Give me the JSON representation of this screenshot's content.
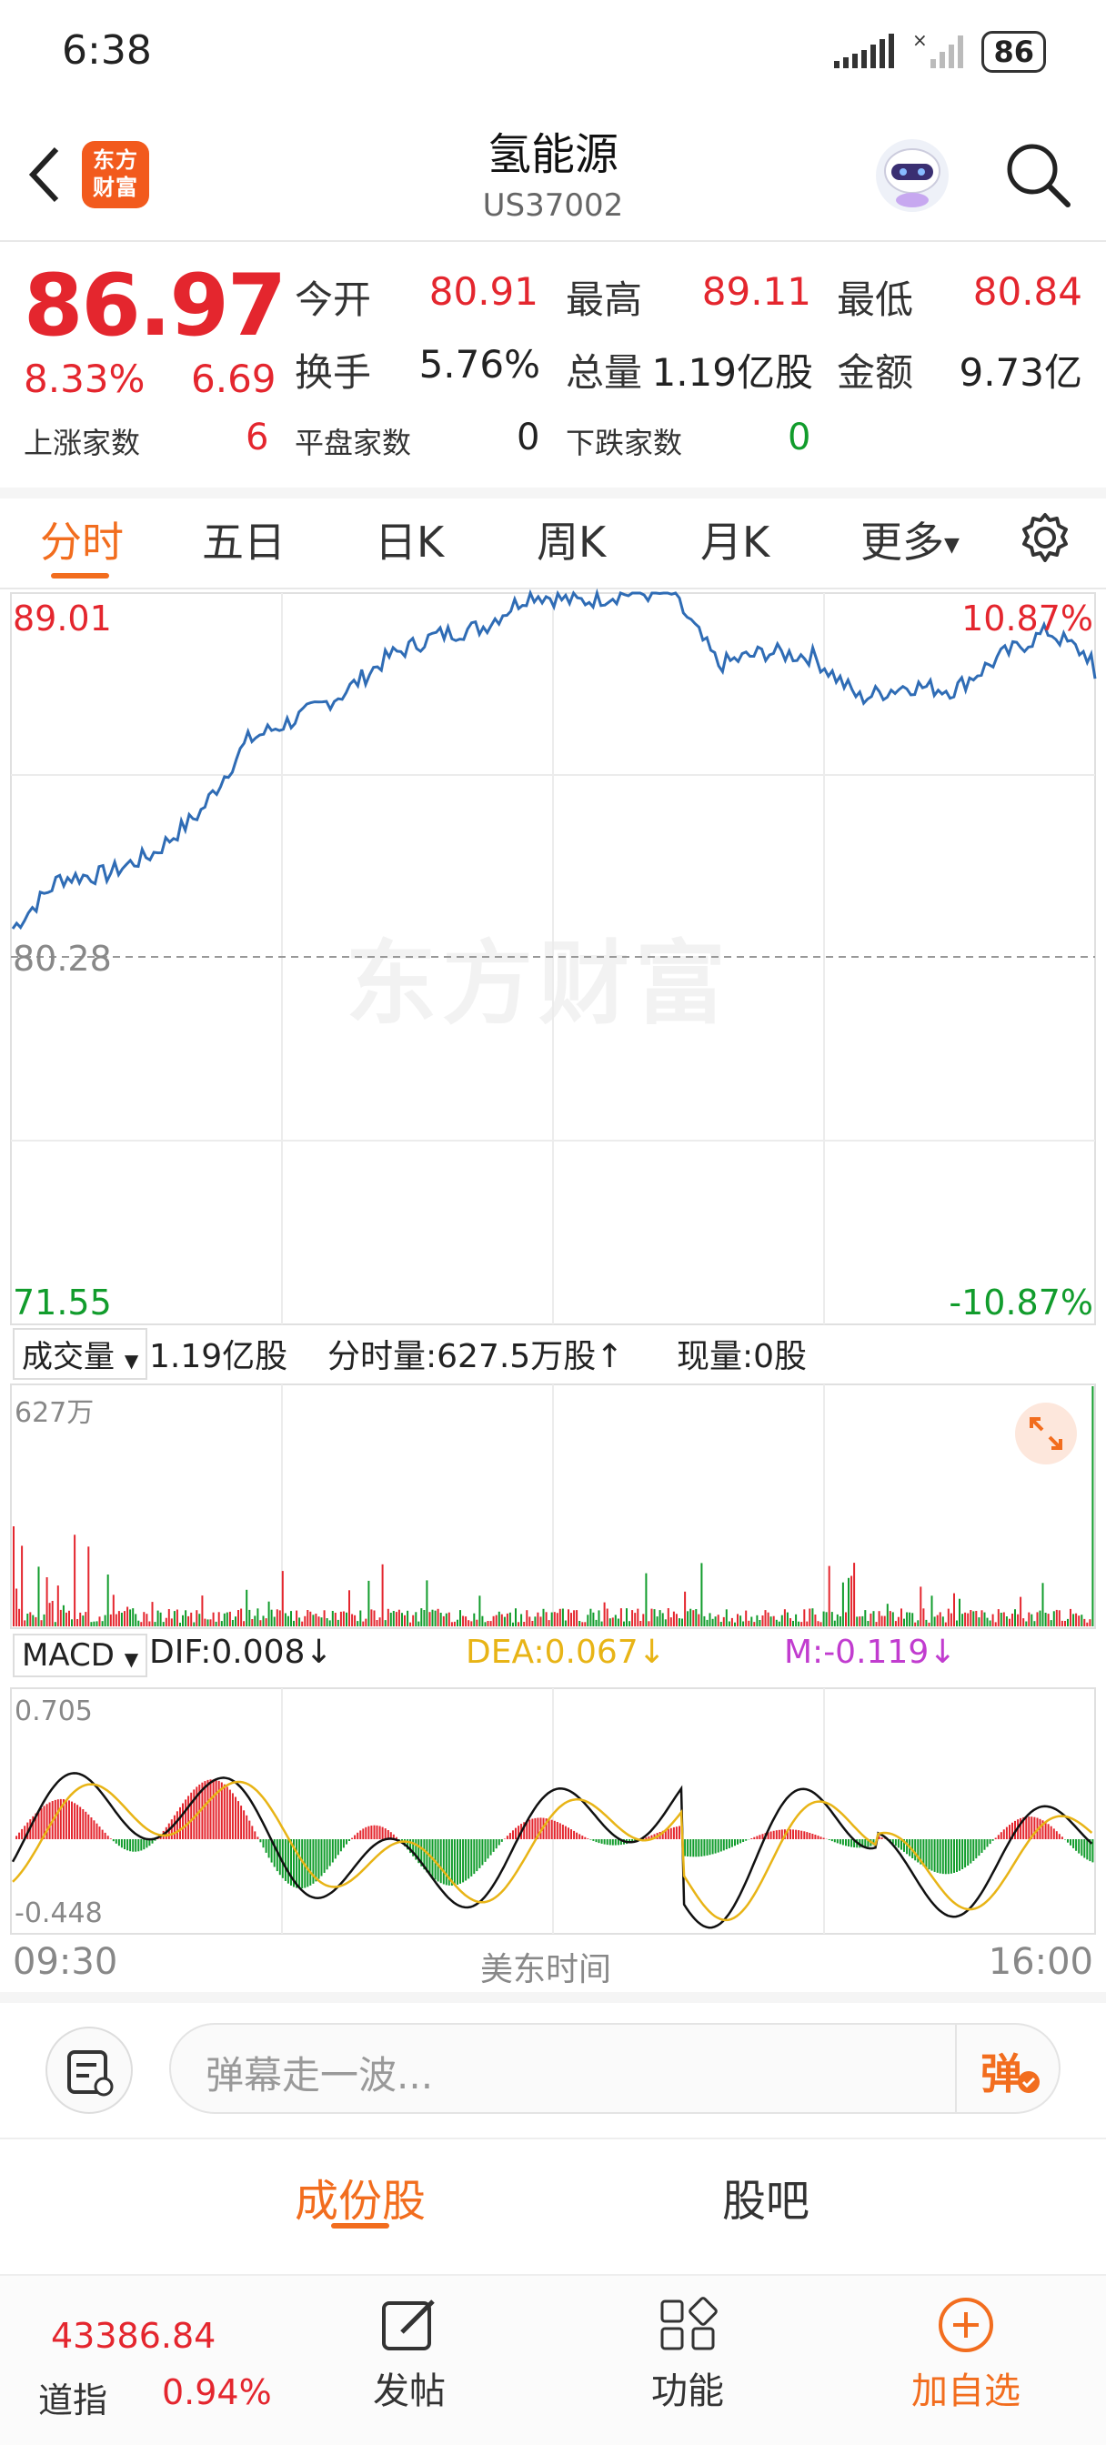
{
  "status_bar": {
    "time": "6:38",
    "battery": "86"
  },
  "header": {
    "title": "氢能源",
    "code": "US37002",
    "logo_text": "东方财富"
  },
  "quote": {
    "price": "86.97",
    "change_pct": "8.33%",
    "change": "6.69",
    "open_label": "今开",
    "open": "80.91",
    "high_label": "最高",
    "high": "89.11",
    "low_label": "最低",
    "low": "80.84",
    "turnover_label": "换手",
    "turnover": "5.76%",
    "volume_label": "总量",
    "volume": "1.19亿股",
    "amount_label": "金额",
    "amount": "9.73亿",
    "up_label": "上涨家数",
    "up_count": "6",
    "flat_label": "平盘家数",
    "flat_count": "0",
    "down_label": "下跌家数",
    "down_count": "0"
  },
  "tabs": [
    "分时",
    "五日",
    "日K",
    "周K",
    "月K",
    "更多"
  ],
  "chart": {
    "watermark": "东方财富",
    "price_top": "89.01",
    "price_mid": "80.28",
    "price_bottom": "71.55",
    "pct_top": "10.87%",
    "pct_bottom": "-10.87%",
    "vol_selector": "成交量",
    "vol_total": "1.19亿股",
    "vol_minute": "分时量:627.5万股↑",
    "vol_now": "现量:0股",
    "vol_max": "627万",
    "macd_selector": "MACD",
    "dif": "DIF:0.008↓",
    "dea": "DEA:0.067↓",
    "m": "M:-0.119↓",
    "macd_top": "0.705",
    "macd_bottom": "-0.448",
    "time_start": "09:30",
    "time_label": "美东时间",
    "time_end": "16:00"
  },
  "chart_data": {
    "type": "line",
    "title": "",
    "x": [
      "09:30",
      "16:00"
    ],
    "prev_close": 80.28,
    "ylim": [
      71.55,
      89.01
    ],
    "series": [
      {
        "name": "",
        "values": [
          81.0,
          82.2,
          82.3,
          82.8,
          83.8,
          85.5,
          86.0,
          86.6,
          87.5,
          88.0,
          88.2,
          89.0,
          88.8,
          89.0,
          89.0,
          87.3,
          87.6,
          87.5,
          86.5,
          86.8,
          86.7,
          87.5,
          88.1,
          87.4
        ]
      }
    ],
    "macd_range": [
      -0.448,
      0.705
    ],
    "colors": {
      "price_line": "#2f6cb5",
      "up": "#e4262e",
      "down": "#119c2c",
      "dea": "#e8b416",
      "m": "#c13ccf",
      "accent": "#f26d1e"
    }
  },
  "comment": {
    "placeholder": "弹幕走一波...",
    "danmu_btn": "弹"
  },
  "section_tabs": [
    "成份股",
    "股吧"
  ],
  "index": {
    "value": "43386.84",
    "name": "道指",
    "pct": "0.94%"
  },
  "bottom_nav": [
    "发帖",
    "功能",
    "加自选"
  ]
}
